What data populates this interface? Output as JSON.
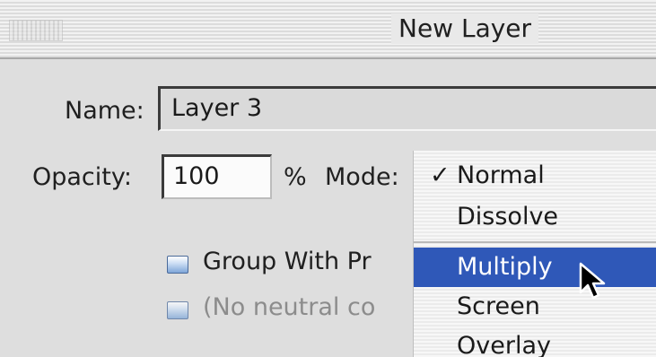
{
  "window": {
    "title": "New Layer"
  },
  "form": {
    "name_label": "Name:",
    "name_value": "Layer 3",
    "opacity_label": "Opacity:",
    "opacity_value": "100",
    "percent_symbol": "%",
    "mode_label": "Mode:"
  },
  "checkboxes": [
    {
      "label": "Group With Pr",
      "checked": false,
      "enabled": true
    },
    {
      "label": "(No neutral co",
      "checked": false,
      "enabled": false
    }
  ],
  "mode_menu": {
    "checkmark": "✓",
    "items": [
      {
        "label": "Normal",
        "checked": true
      },
      {
        "label": "Dissolve"
      },
      {
        "label": "Multiply",
        "highlighted": true
      },
      {
        "label": "Screen"
      },
      {
        "label": "Overlay"
      }
    ]
  },
  "colors": {
    "highlight": "#2f58b8",
    "background": "#dedede"
  },
  "icons": {
    "pointer": "arrow-cursor-icon"
  }
}
